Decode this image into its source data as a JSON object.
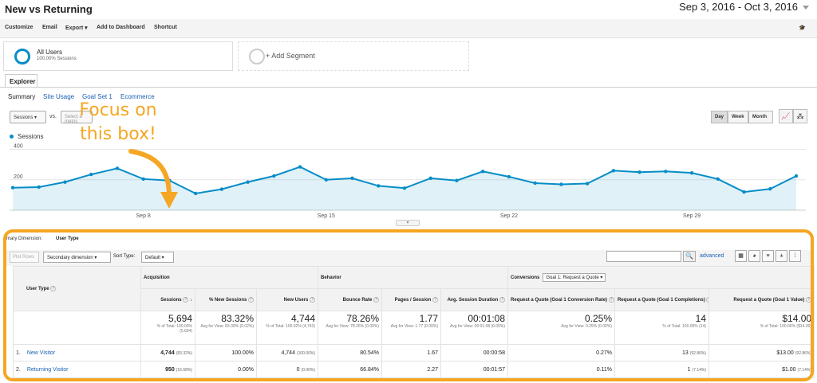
{
  "page": {
    "title": "New vs Returning",
    "date_range": "Sep 3, 2016 - Oct 3, 2016"
  },
  "toolbar": {
    "customize": "Customize",
    "email": "Email",
    "export": "Export ▾",
    "add_to_dashboard": "Add to Dashboard",
    "shortcut": "Shortcut",
    "cap_icon": "graduation-cap-icon"
  },
  "segments": {
    "active_title": "All Users",
    "active_sub": "100.00% Sessions",
    "add_label": "+ Add Segment"
  },
  "explorer": {
    "tab_label": "Explorer",
    "subtabs": [
      "Summary",
      "Site Usage",
      "Goal Set 1",
      "Ecommerce"
    ]
  },
  "chart_controls": {
    "metric_select": "Sessions",
    "vs_label": "vs.",
    "compare_select": "Select a metric",
    "granularity": [
      "Day",
      "Week",
      "Month"
    ]
  },
  "annotation": {
    "text_line1": "Focus on",
    "text_line2": "this box!",
    "color": "#f5a623"
  },
  "chart_data": {
    "type": "area",
    "legend": "Sessions",
    "yticks": [
      200,
      400
    ],
    "ylim": [
      0,
      450
    ],
    "x_tick_labels": [
      "Sep 8",
      "Sep 15",
      "Sep 22",
      "Sep 29"
    ],
    "x_tick_index": [
      5,
      12,
      19,
      26
    ],
    "values": [
      148,
      152,
      185,
      235,
      275,
      205,
      195,
      110,
      138,
      185,
      225,
      285,
      200,
      210,
      160,
      145,
      210,
      195,
      255,
      220,
      178,
      170,
      175,
      260,
      250,
      255,
      245,
      205,
      120,
      140,
      225
    ],
    "color": "#058dc7"
  },
  "table_controls": {
    "primary_dimension_label": "mary Dimension:",
    "primary_dimension_value": "User Type",
    "plot_rows": "Plot Rows",
    "secondary_dimension": "Secondary dimension",
    "sort_type_label": "Sort Type:",
    "sort_type_value": "Default",
    "advanced": "advanced"
  },
  "table": {
    "dimension_header": "User Type",
    "groups": {
      "acquisition": "Acquisition",
      "behavior": "Behavior",
      "conversions": "Conversions",
      "goal_select": "Goal 1: Request a Quote"
    },
    "columns": [
      "Sessions",
      "% New Sessions",
      "New Users",
      "Bounce Rate",
      "Pages / Session",
      "Avg. Session Duration",
      "Request a Quote (Goal 1 Conversion Rate)",
      "Request a Quote (Goal 1 Completions)",
      "Request a Quote (Goal 1 Value)"
    ],
    "totals": [
      {
        "main": "5,694",
        "sub": "% of Total: 100.00% (5,694)"
      },
      {
        "main": "83.32%",
        "sub": "Avg for View: 83.30% (0.02%)"
      },
      {
        "main": "4,744",
        "sub": "% of Total: 100.02% (4,743)"
      },
      {
        "main": "78.26%",
        "sub": "Avg for View: 78.26% (0.00%)"
      },
      {
        "main": "1.77",
        "sub": "Avg for View: 1.77 (0.00%)"
      },
      {
        "main": "00:01:08",
        "sub": "Avg for View: 00:01:08 (0.00%)"
      },
      {
        "main": "0.25%",
        "sub": "Avg for View: 0.25% (0.00%)"
      },
      {
        "main": "14",
        "sub": "% of Total: 100.00% (14)"
      },
      {
        "main": "$14.00",
        "sub": "% of Total: 100.00% ($14.00)"
      }
    ],
    "rows": [
      {
        "num": "1.",
        "label": "New Visitor",
        "cells": [
          {
            "v": "4,744",
            "p": "(83.32%)"
          },
          {
            "v": "100.00%",
            "p": ""
          },
          {
            "v": "4,744",
            "p": "(100.00%)"
          },
          {
            "v": "80.54%",
            "p": ""
          },
          {
            "v": "1.67",
            "p": ""
          },
          {
            "v": "00:00:58",
            "p": ""
          },
          {
            "v": "0.27%",
            "p": ""
          },
          {
            "v": "13",
            "p": "(92.86%)"
          },
          {
            "v": "$13.00",
            "p": "(92.86%)"
          }
        ]
      },
      {
        "num": "2.",
        "label": "Returning Visitor",
        "cells": [
          {
            "v": "950",
            "p": "(16.68%)"
          },
          {
            "v": "0.00%",
            "p": ""
          },
          {
            "v": "0",
            "p": "(0.00%)"
          },
          {
            "v": "66.84%",
            "p": ""
          },
          {
            "v": "2.27",
            "p": ""
          },
          {
            "v": "00:01:57",
            "p": ""
          },
          {
            "v": "0.11%",
            "p": ""
          },
          {
            "v": "1",
            "p": "(7.14%)"
          },
          {
            "v": "$1.00",
            "p": "(7.14%)"
          }
        ]
      }
    ]
  }
}
